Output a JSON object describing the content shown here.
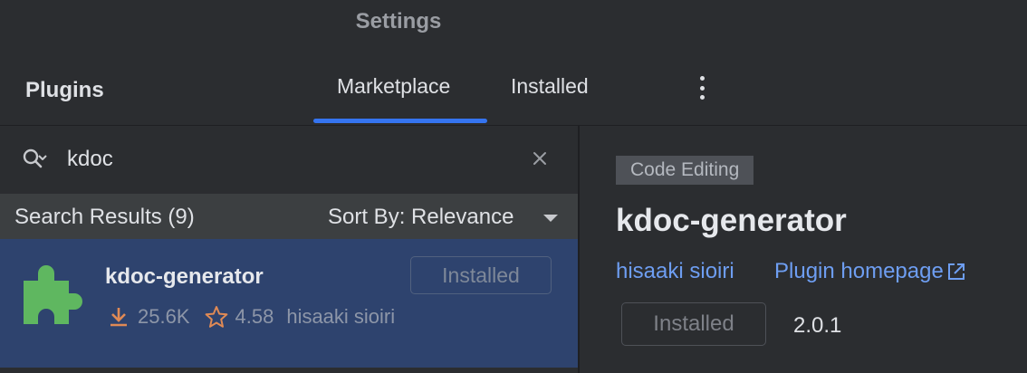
{
  "window": {
    "title": "Settings"
  },
  "sidebar": {
    "section_label": "Plugins"
  },
  "tabs": [
    {
      "label": "Marketplace",
      "active": true
    },
    {
      "label": "Installed",
      "active": false
    }
  ],
  "search": {
    "value": "kdoc",
    "placeholder": ""
  },
  "results": {
    "count_label": "Search Results (9)",
    "sort_label": "Sort By: Relevance"
  },
  "plugin_list": [
    {
      "name": "kdoc-generator",
      "status_button": "Installed",
      "downloads": "25.6K",
      "rating": "4.58",
      "author": "hisaaki sioiri",
      "icon": "puzzle-piece-icon"
    }
  ],
  "detail": {
    "category": "Code Editing",
    "name": "kdoc-generator",
    "author": "hisaaki sioiri",
    "homepage_label": "Plugin homepage",
    "button_label": "Installed",
    "version": "2.0.1"
  },
  "colors": {
    "accent": "#3574f0",
    "link": "#6e9ef2",
    "selection": "#2e436e",
    "plugin_icon": "#5fb760",
    "download_icon": "#e08a55",
    "star_icon": "#e08a55"
  }
}
